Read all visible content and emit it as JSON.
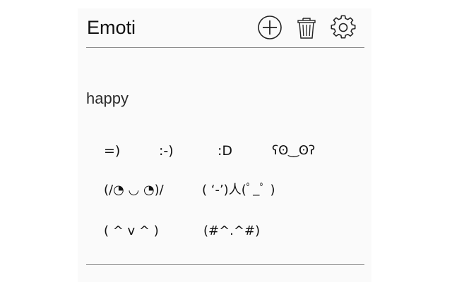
{
  "header": {
    "title": "Emoti",
    "icons": [
      "add-circle-icon",
      "trash-icon",
      "gear-icon"
    ]
  },
  "category": {
    "label": "happy"
  },
  "emoticons": [
    "=)",
    ":-)",
    ":D",
    "ʕʘ‿ʘʔ",
    "(/◔ ◡ ◔)/",
    "( ‘-’)人(ﾟ_ﾟ )",
    "( ^  v  ^ )",
    "(#^.^#)"
  ]
}
